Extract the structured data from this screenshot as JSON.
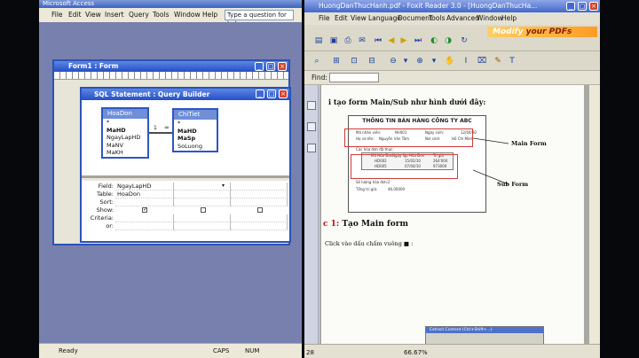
{
  "access": {
    "title": "Microsoft Access",
    "menu": [
      "File",
      "Edit",
      "View",
      "Insert",
      "Query",
      "Tools",
      "Window",
      "Help"
    ],
    "help_placeholder": "Type a question for help",
    "status": {
      "ready": "Ready",
      "caps": "CAPS",
      "num": "NUM"
    },
    "form1": {
      "title": "Form1 : Form"
    },
    "query_builder": {
      "title": "SQL Statement : Query Builder",
      "tables": [
        {
          "name": "HoaDon",
          "fields": [
            "*",
            "MaHD",
            "NgayLapHD",
            "MaNV",
            "MaKH"
          ],
          "key_fields": [
            1
          ]
        },
        {
          "name": "ChiTiet",
          "fields": [
            "*",
            "MaHD",
            "MaSp",
            "SoLuong"
          ],
          "key_fields": [
            1,
            2
          ]
        }
      ],
      "relationship": {
        "one": "1",
        "many": "∞"
      },
      "grid": {
        "row_labels": [
          "Field:",
          "Table:",
          "Sort:",
          "Show:",
          "Criteria:",
          "or:"
        ],
        "columns": [
          {
            "field": "NgayLapHD",
            "table": "HoaDon",
            "show": true
          },
          {
            "field": "",
            "table": "",
            "show": false
          },
          {
            "field": "",
            "table": "",
            "show": false
          }
        ]
      }
    }
  },
  "foxit": {
    "title": "HuongDanThucHanh.pdf - Foxit Reader 3.0 - [HuongDanThucHa...",
    "menu": [
      "File",
      "Edit",
      "View",
      "Language",
      "Document",
      "Tools",
      "Advanced",
      "Window",
      "Help"
    ],
    "banner": {
      "part1": "Modify ",
      "part2": "your PDFs"
    },
    "find_label": "Find:",
    "status": {
      "page": "28",
      "zoom": "66.67%"
    },
    "document": {
      "heading": "i tạo form Main/Sub như hình dưới đây:",
      "form_title": "THÔNG TIN BÁN HÀNG CÔNG TY ABC",
      "main_fields": [
        {
          "label": "Mã nhân viên:",
          "value": "NV001"
        },
        {
          "label": "Ngày sinh:",
          "value": "12/04/80"
        },
        {
          "label": "Họ và tên:",
          "value": "Nguyễn Văn Tâm"
        },
        {
          "label": "Nơi sinh:",
          "value": "Hồ Chí Minh"
        }
      ],
      "sub_caption": "Các hóa đơn đã thực:",
      "sub_headers": [
        "Mã Hóa Đơn",
        "Ngày lập Hóa Đơn",
        "Trị giá"
      ],
      "sub_rows": [
        [
          "HD002",
          "15/02/10",
          "264'000"
        ],
        [
          "HD005",
          "07/04/10",
          "973000"
        ]
      ],
      "footer_lines": [
        "Số lượng hóa đơn:",
        "Tổng trị giá:"
      ],
      "footer_values": [
        "2",
        "46,00000"
      ],
      "label_main": "Main Form",
      "label_sub": "Sub Form",
      "section_num": "c 1:",
      "section_title": "Tạo Main form",
      "body": "Click vào dấu chấm vuông ■ :"
    },
    "overlay_title": "Extract Content (Ctrl+Shift+...)"
  }
}
